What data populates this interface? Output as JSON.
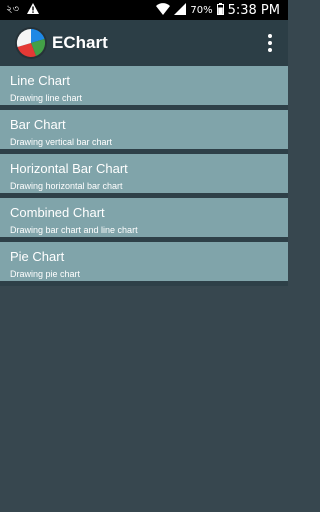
{
  "statusbar": {
    "left_text": "২৩",
    "battery": "70%",
    "time": "5:38 PM"
  },
  "app": {
    "title": "EChart",
    "logo_colors": [
      "#e53935",
      "#1e88e5",
      "#43a047",
      "#ffffff"
    ]
  },
  "items": [
    {
      "title": "Line Chart",
      "subtitle": "Drawing line chart"
    },
    {
      "title": "Bar Chart",
      "subtitle": "Drawing vertical bar chart"
    },
    {
      "title": "Horizontal Bar Chart",
      "subtitle": "Drawing horizontal bar chart"
    },
    {
      "title": "Combined Chart",
      "subtitle": "Drawing bar chart and line chart"
    },
    {
      "title": "Pie Chart",
      "subtitle": "Drawing pie chart"
    }
  ],
  "colors": {
    "list_item_bg": "#80a4aa",
    "app_bar_bg": "#2c3e46",
    "page_bg": "#37474f"
  }
}
